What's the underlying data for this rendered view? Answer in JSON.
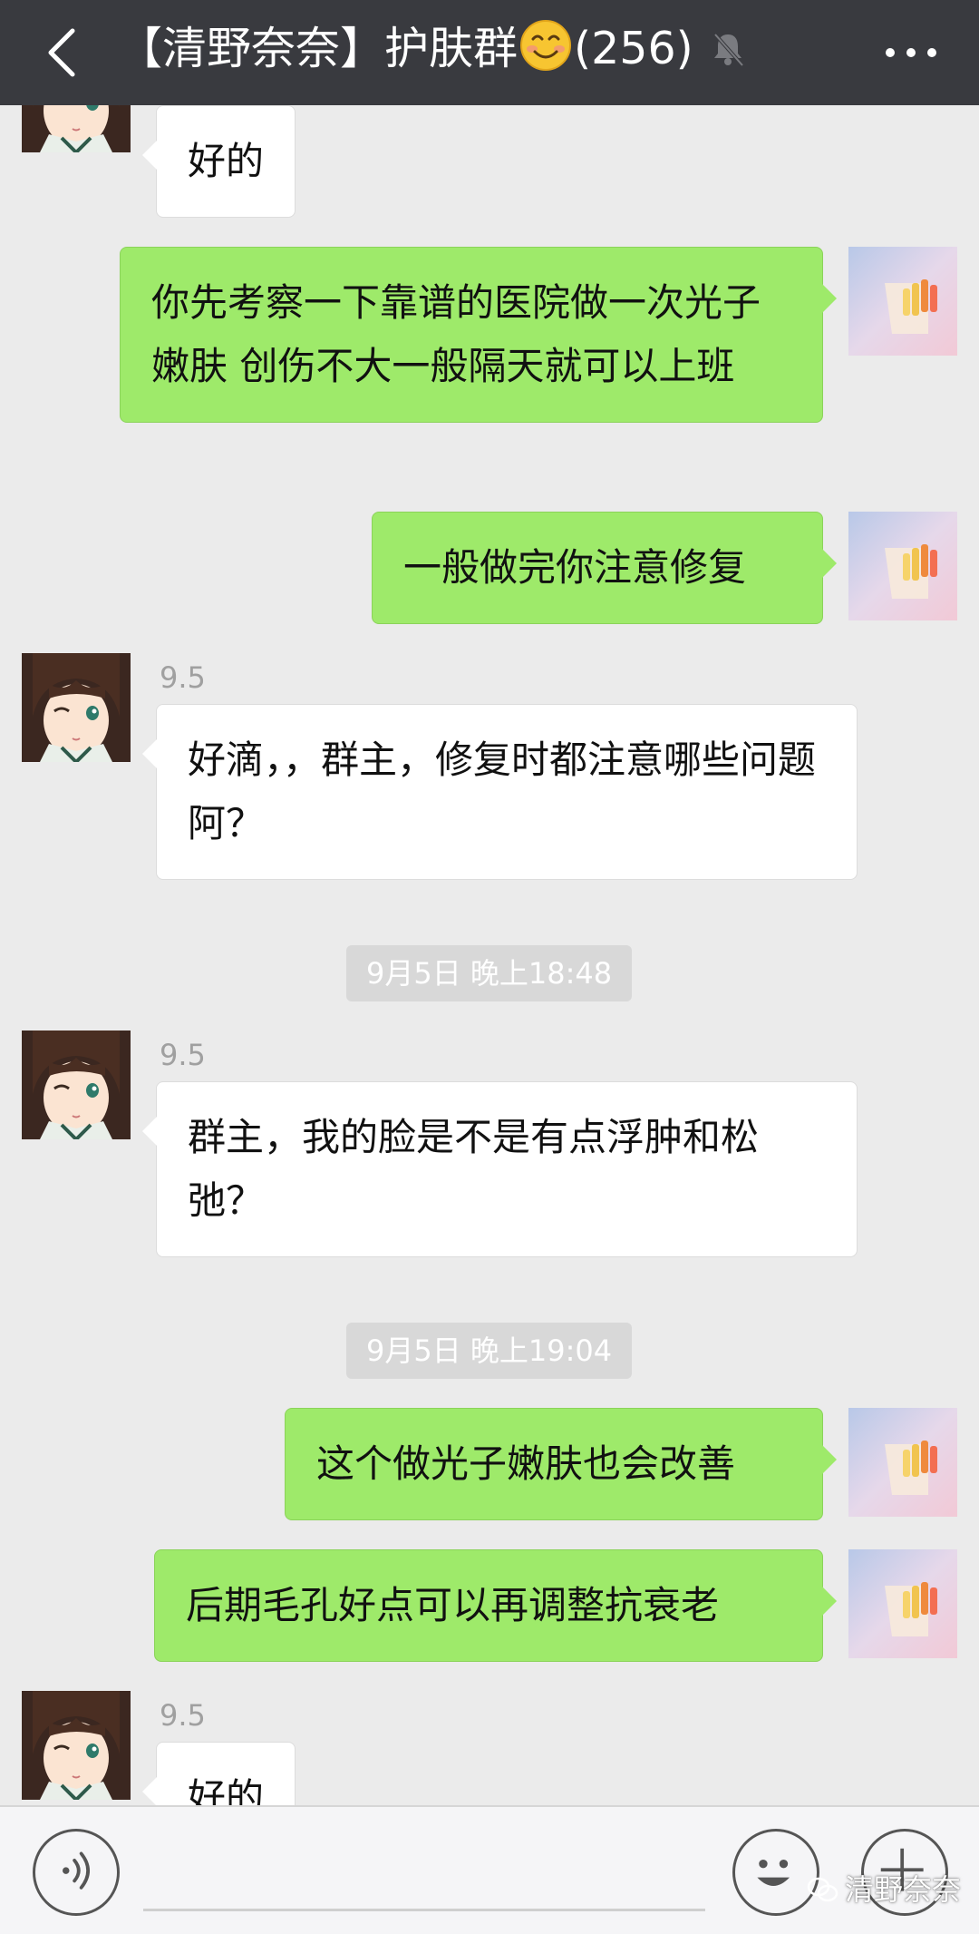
{
  "header": {
    "title": "【清野奈奈】护肤群",
    "member_count": "(256)"
  },
  "messages": [
    {
      "type": "text",
      "side": "left",
      "text": "好的"
    },
    {
      "type": "text",
      "side": "right",
      "text": "你先考察一下靠谱的医院做一次光子嫩肤 创伤不大一般隔天就可以上班"
    },
    {
      "type": "text",
      "side": "right",
      "text": "一般做完你注意修复"
    },
    {
      "type": "text",
      "side": "left",
      "sender": "9.5",
      "text": "好滴，，群主，修复时都注意哪些问题阿？"
    },
    {
      "type": "time",
      "text": "9月5日 晚上18:48"
    },
    {
      "type": "text",
      "side": "left",
      "sender": "9.5",
      "text": "群主，我的脸是不是有点浮肿和松弛？"
    },
    {
      "type": "time",
      "text": "9月5日 晚上19:04"
    },
    {
      "type": "text",
      "side": "right",
      "text": "这个做光子嫩肤也会改善"
    },
    {
      "type": "text",
      "side": "right",
      "text": "后期毛孔好点可以再调整抗衰老"
    },
    {
      "type": "text",
      "side": "left",
      "sender": "9.5",
      "text": "好的"
    }
  ],
  "watermark": "清野奈奈",
  "colors": {
    "titlebar": "#393a3f",
    "chat_background": "#ebebeb",
    "sent_bubble": "#9eea6a",
    "received_bubble": "#ffffff",
    "time_chip": "#d8d8d8"
  },
  "icons": [
    "back-arrow-icon",
    "smiley-emoji-icon",
    "mute-bell-icon",
    "more-dots-icon",
    "voice-icon",
    "emoji-icon",
    "plus-icon",
    "wechat-logo-icon"
  ]
}
